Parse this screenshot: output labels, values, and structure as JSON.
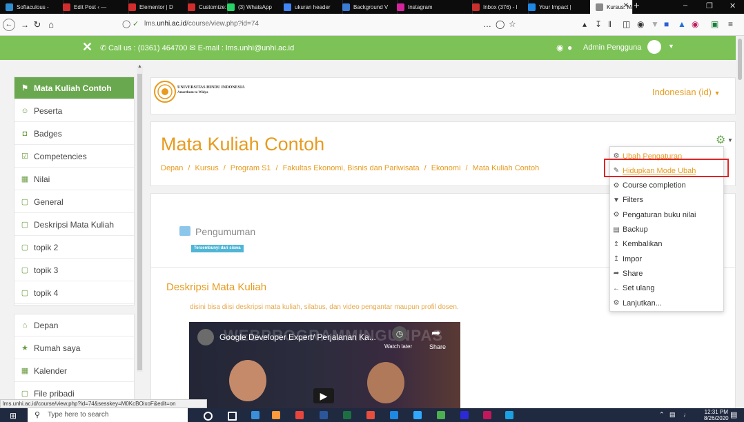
{
  "browser": {
    "tabs": [
      {
        "label": "Softaculous - ",
        "color": "#2f8fd1"
      },
      {
        "label": "Edit Post ‹ —",
        "color": "#d22d2d"
      },
      {
        "label": "Elementor | D",
        "color": "#d22d2d"
      },
      {
        "label": "Customize: De",
        "color": "#d22d2d"
      },
      {
        "label": "(3) WhatsApp",
        "color": "#25d366"
      },
      {
        "label": "ukuran header",
        "color": "#4285f4"
      },
      {
        "label": "Background V",
        "color": "#3b7bd4"
      },
      {
        "label": "Instagram",
        "color": "#d6249f"
      },
      {
        "label": "Inbox (376) - l",
        "color": "#c9302c"
      },
      {
        "label": "Your Impact |",
        "color": "#1e88e5"
      },
      {
        "label": "Kursus: Ma",
        "color": "#8a8a8a"
      }
    ],
    "url_prefix": "lms.",
    "url_domain": "unhi.ac.id",
    "url_path": "/course/view.php?id=74",
    "url_more": "…",
    "status_url": "lms.unhi.ac.id/course/view.php?id=74&sesskey=M0KcBOixoF&edit=on"
  },
  "header": {
    "contact": "Call us : (0361) 464700 ✉ E-mail : lms.unhi@unhi.ac.id",
    "user_name": "Admin Pengguna"
  },
  "nav": {
    "top_items": [
      {
        "label": "Mata Kuliah Contoh",
        "icon": "⚑",
        "active": true
      },
      {
        "label": "Peserta",
        "icon": "☺",
        "active": false
      },
      {
        "label": "Badges",
        "icon": "◘",
        "active": false
      },
      {
        "label": "Competencies",
        "icon": "☑",
        "active": false
      },
      {
        "label": "Nilai",
        "icon": "▦",
        "active": false
      },
      {
        "label": "General",
        "icon": "▢",
        "active": false
      },
      {
        "label": "Deskripsi Mata Kuliah",
        "icon": "▢",
        "active": false
      },
      {
        "label": "topik 2",
        "icon": "▢",
        "active": false
      },
      {
        "label": "topik 3",
        "icon": "▢",
        "active": false
      },
      {
        "label": "topik 4",
        "icon": "▢",
        "active": false
      }
    ],
    "bottom_items": [
      {
        "label": "Depan",
        "icon": "⌂"
      },
      {
        "label": "Rumah saya",
        "icon": "★"
      },
      {
        "label": "Kalender",
        "icon": "▦"
      },
      {
        "label": "File pribadi",
        "icon": "▢"
      }
    ]
  },
  "brand": {
    "university_name": "UNIVERSITAS HINDU INDONESIA",
    "motto": "Amerthum tu Widya",
    "language": "Indonesian (id)"
  },
  "course": {
    "title": "Mata Kuliah Contoh",
    "breadcrumb": [
      "Depan",
      "Kursus",
      "Program S1",
      "Fakultas Ekonomi, Bisnis dan Pariwisata",
      "Ekonomi",
      "Mata Kuliah Contoh"
    ],
    "breadcrumb_sep": "/",
    "announcement_label": "Pengumuman",
    "hidden_badge": "Tersembunyi dari siswa",
    "section_title": "Deskripsi Mata Kuliah",
    "section_text": "disini bisa diisi deskripsi mata kuliah, silabus, dan video pengantar maupun profil dosen."
  },
  "settings_menu": {
    "items": [
      {
        "label": "Ubah Pengaturan",
        "icon": "⚙",
        "color": "#e79b1f"
      },
      {
        "label": "Hidupkan Mode Ubah",
        "icon": "✎",
        "color": "#e79b1f",
        "underline": true
      },
      {
        "label": "Course completion",
        "icon": "⚙",
        "color": "#333333"
      },
      {
        "label": "Filters",
        "icon": "▼",
        "color": "#333333"
      },
      {
        "label": "Pengaturan buku nilai",
        "icon": "⚙",
        "color": "#333333"
      },
      {
        "label": "Backup",
        "icon": "▤",
        "color": "#333333"
      },
      {
        "label": "Kembalikan",
        "icon": "↥",
        "color": "#333333"
      },
      {
        "label": "Impor",
        "icon": "↥",
        "color": "#333333"
      },
      {
        "label": "Share",
        "icon": "➦",
        "color": "#333333"
      },
      {
        "label": "Set ulang",
        "icon": "←",
        "color": "#333333"
      },
      {
        "label": "Lanjutkan...",
        "icon": "⚙",
        "color": "#333333"
      }
    ]
  },
  "video": {
    "title": "Google Developer Expert/ Perjalanan Ka...",
    "watch_later": "Watch later",
    "share": "Share",
    "overlay_text": "WEBPROGRAMMINGUNPAS"
  },
  "taskbar": {
    "search_placeholder": "Type here to search",
    "time": "12:31 PM",
    "date": "8/26/2020"
  },
  "colors": {
    "accent": "#7dc257",
    "orange": "#e79b1f",
    "highlight": "#e02424"
  }
}
